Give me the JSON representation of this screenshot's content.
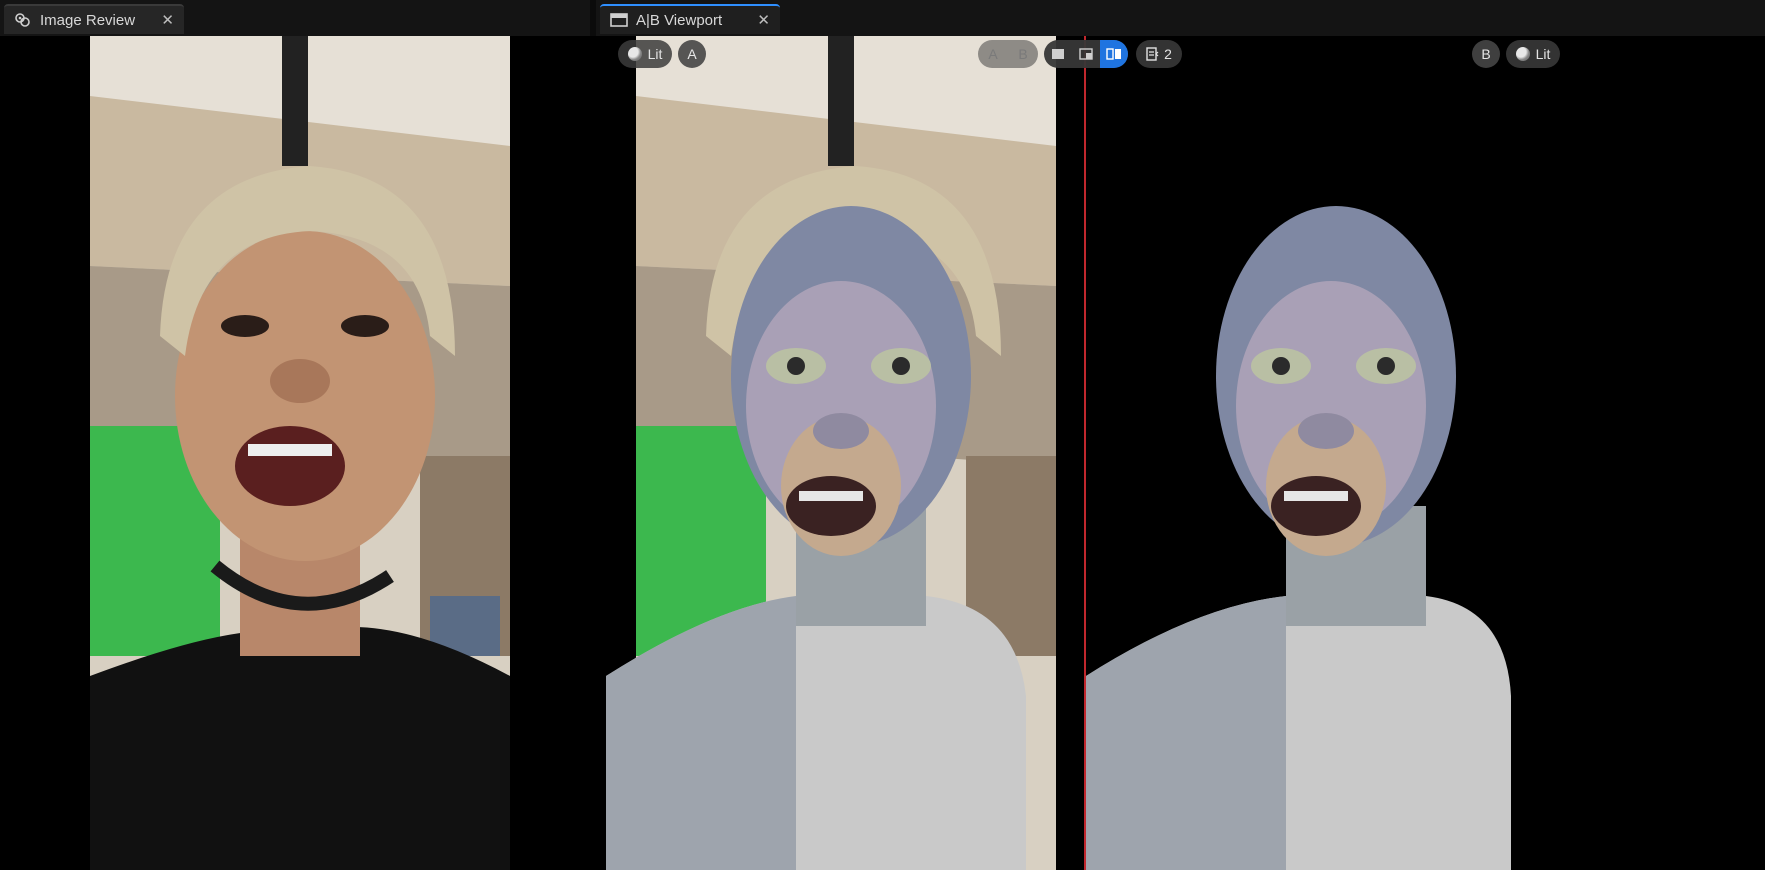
{
  "tabs": [
    {
      "label": "Image Review",
      "icon": "image-review-icon",
      "active": false
    },
    {
      "label": "A|B Viewport",
      "icon": "viewport-icon",
      "active": true
    }
  ],
  "viewport": {
    "left_lit_label": "Lit",
    "left_ab_label": "A",
    "ab_toggle": {
      "a": "A",
      "b": "B"
    },
    "layout_modes": [
      "single-view",
      "wipe-view",
      "dual-view"
    ],
    "selected_layout": "dual-view",
    "view_count": "2",
    "right_ab_label": "B",
    "right_lit_label": "Lit"
  },
  "colors": {
    "accent": "#1f74e0",
    "divider": "#c0272d",
    "greenscreen": "#3cb84e"
  }
}
